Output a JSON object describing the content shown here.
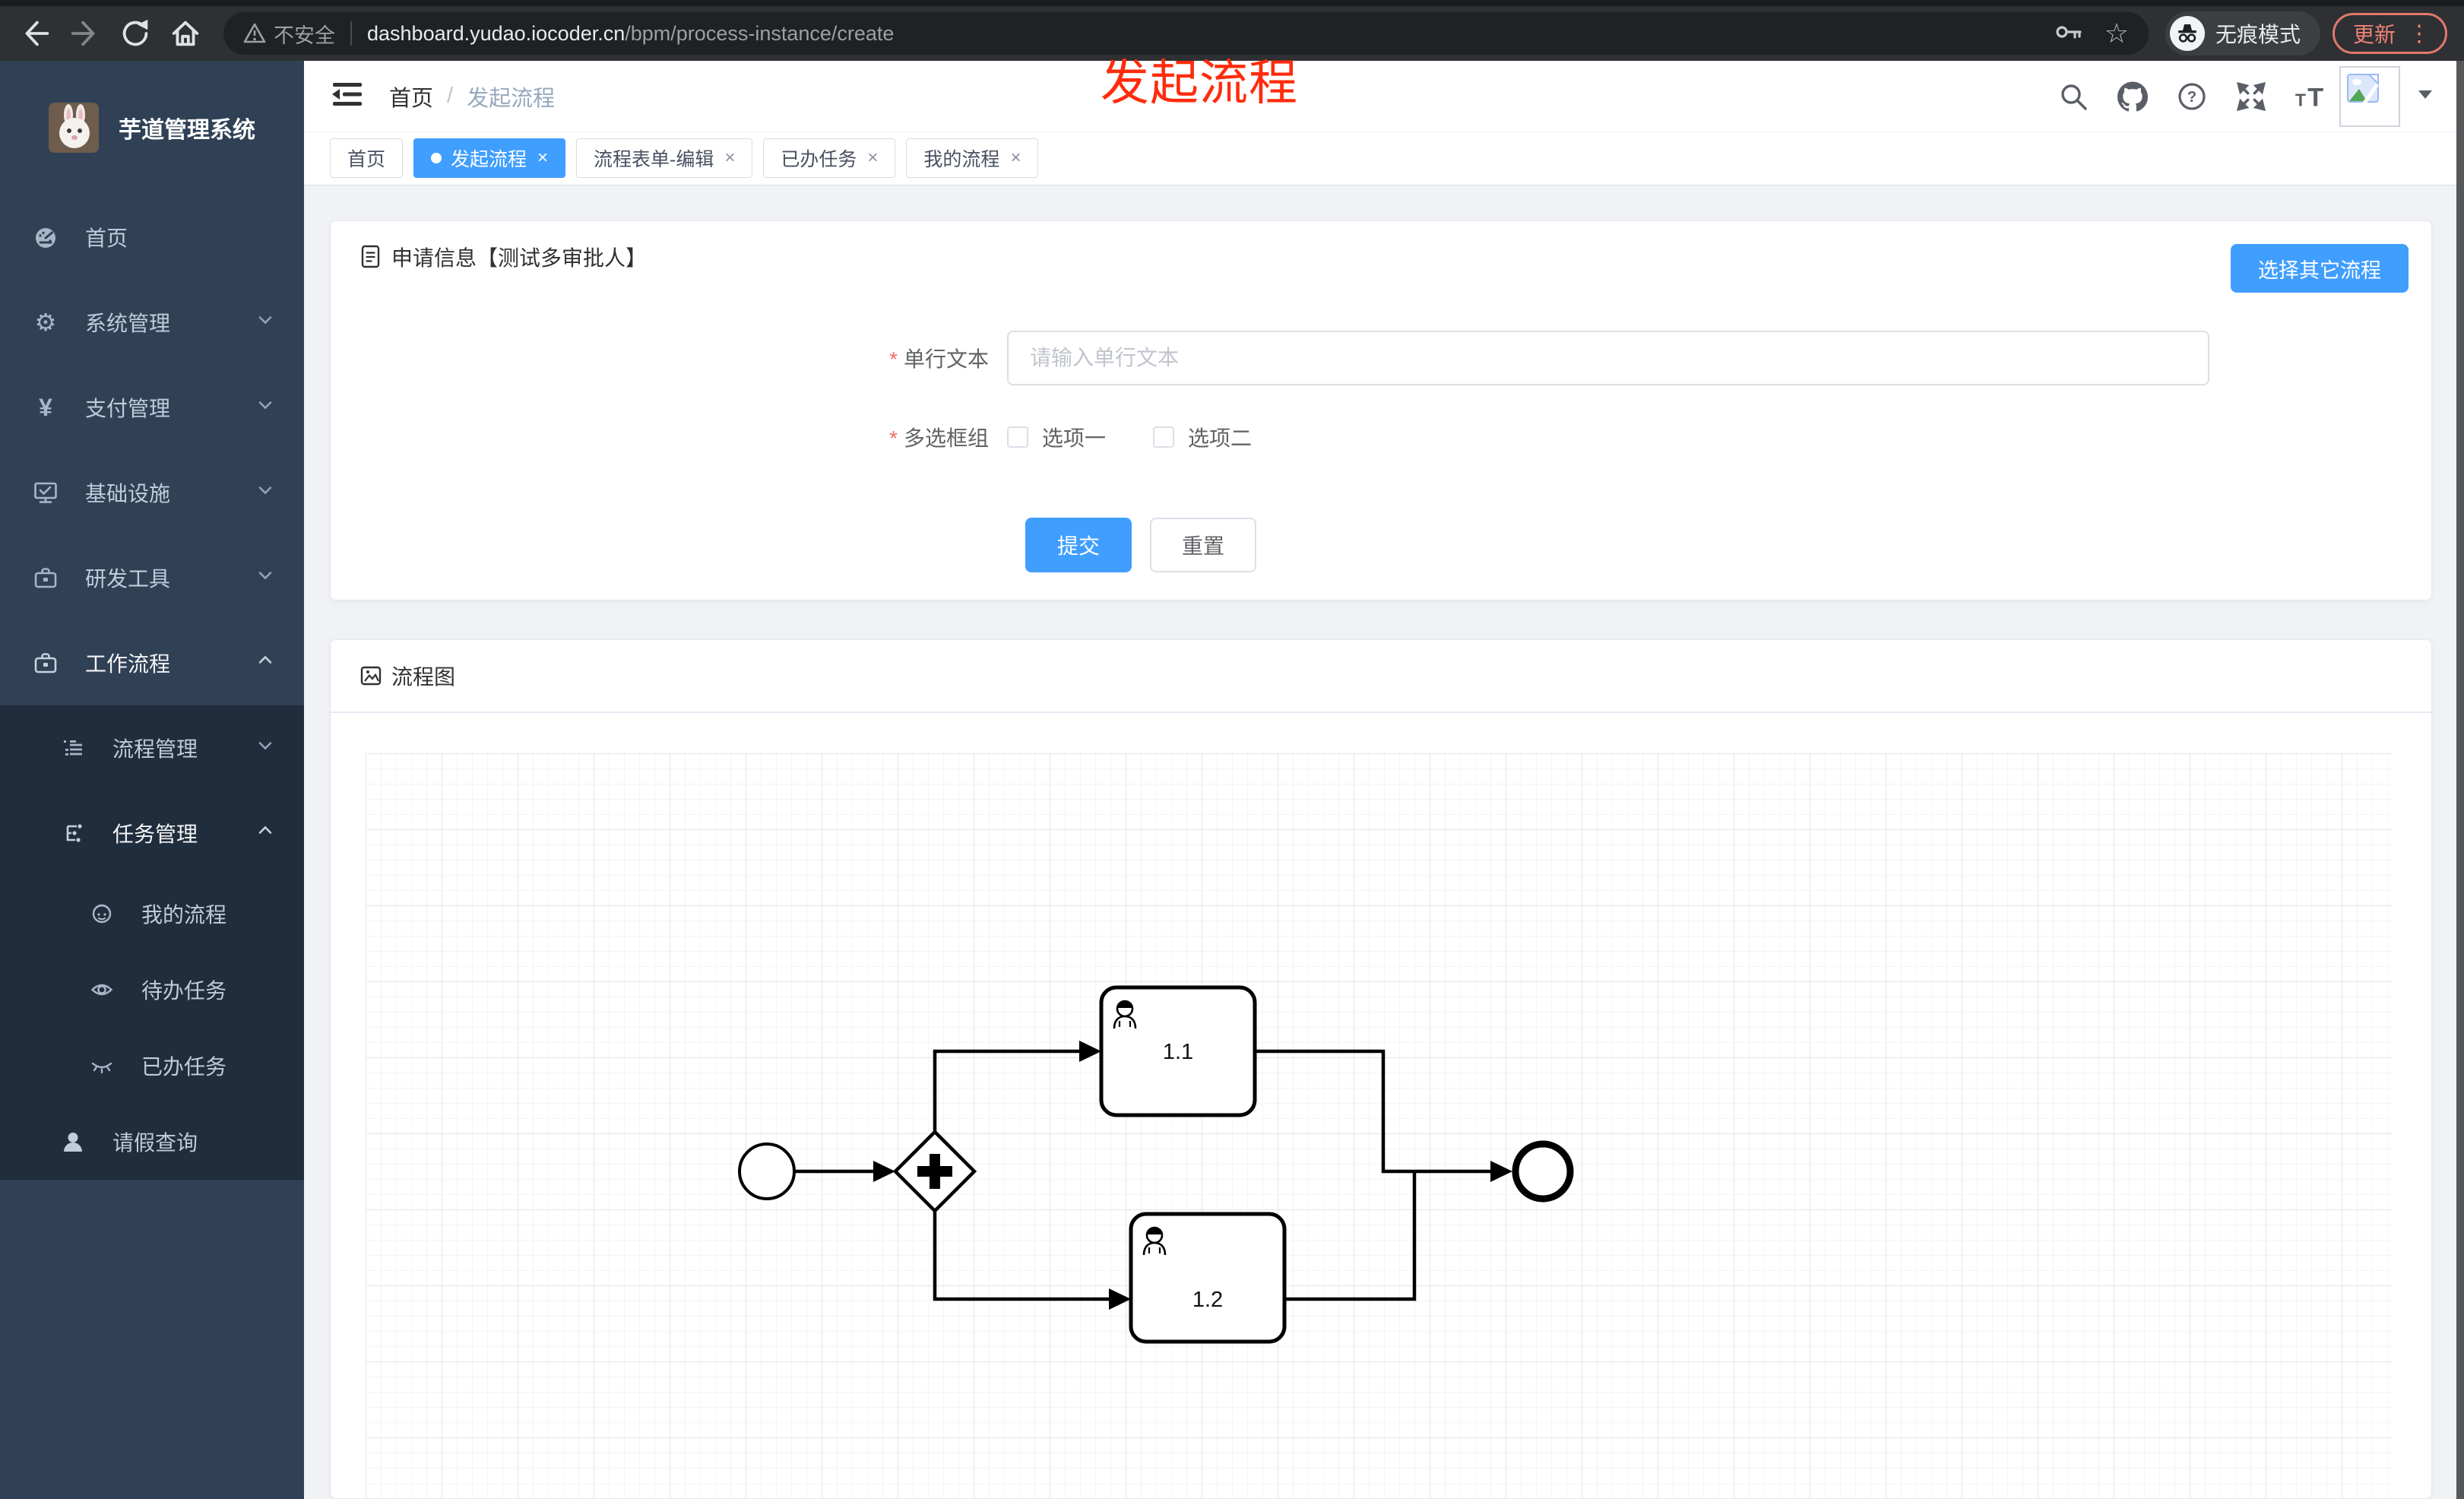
{
  "browser": {
    "security_label": "不安全",
    "url_host": "dashboard.yudao.iocoder.cn",
    "url_path": "/bpm/process-instance/create",
    "incognito_label": "无痕模式",
    "update_label": "更新",
    "menu_dots": "⋮"
  },
  "annotation": {
    "text": "发起流程",
    "color": "#ff2b0d"
  },
  "sidebar": {
    "title": "芋道管理系统",
    "items": [
      {
        "label": "首页"
      },
      {
        "label": "系统管理"
      },
      {
        "label": "支付管理"
      },
      {
        "label": "基础设施"
      },
      {
        "label": "研发工具"
      },
      {
        "label": "工作流程"
      },
      {
        "label": "流程管理"
      },
      {
        "label": "任务管理"
      },
      {
        "label": "我的流程"
      },
      {
        "label": "待办任务"
      },
      {
        "label": "已办任务"
      },
      {
        "label": "请假查询"
      }
    ]
  },
  "breadcrumb": {
    "home": "首页",
    "current": "发起流程"
  },
  "tabs": [
    {
      "label": "首页",
      "active": false,
      "closable": false
    },
    {
      "label": "发起流程",
      "active": true,
      "closable": true
    },
    {
      "label": "流程表单-编辑",
      "active": false,
      "closable": true
    },
    {
      "label": "已办任务",
      "active": false,
      "closable": true
    },
    {
      "label": "我的流程",
      "active": false,
      "closable": true
    }
  ],
  "close_glyph": "×",
  "form_card": {
    "title": "申请信息【测试多审批人】",
    "choose_other_label": "选择其它流程",
    "fields": {
      "text": {
        "label": "单行文本",
        "required": true,
        "value": "",
        "placeholder": "请输入单行文本"
      },
      "checkbox_group": {
        "label": "多选框组",
        "required": true,
        "options": [
          {
            "label": "选项一",
            "checked": false
          },
          {
            "label": "选项二",
            "checked": false
          }
        ]
      }
    },
    "submit_label": "提交",
    "reset_label": "重置"
  },
  "diagram_card": {
    "title": "流程图",
    "nodes": {
      "task1": "1.1",
      "task2": "1.2"
    }
  },
  "colors": {
    "accent": "#409eff",
    "danger": "#f56c6c",
    "sidebar_bg": "#304156",
    "submenu_bg": "#1f2d3d",
    "annotation_red": "#ff2b0d"
  }
}
